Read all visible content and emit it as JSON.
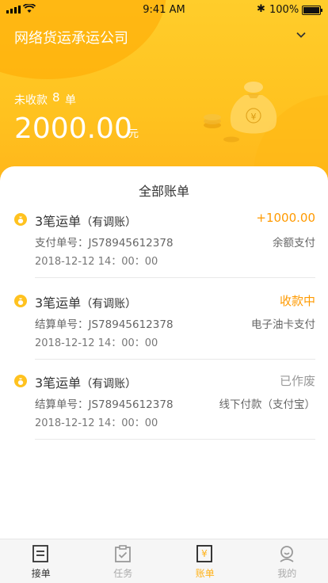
{
  "status_bar": {
    "time": "9:41 AM",
    "battery": "100%"
  },
  "header": {
    "company": "网络货运承运公司",
    "unpaid_label": "未收款",
    "unpaid_count": "8",
    "unpaid_unit": "单",
    "amount": "2000.00",
    "amount_unit": "元"
  },
  "sheet": {
    "title": "全部账单"
  },
  "bills": [
    {
      "title": "3笔运单",
      "note": "（有调账）",
      "right": "+1000.00",
      "right_color": "#ff9a00",
      "sub_left": "支付单号：JS78945612378",
      "sub_right": "余额支付",
      "date": "2018-12-12  14：00：00"
    },
    {
      "title": "3笔运单",
      "note": "（有调账）",
      "right": "收款中",
      "right_color": "#ff9a00",
      "sub_left": "结算单号：JS78945612378",
      "sub_right": "电子油卡支付",
      "date": "2018-12-12  14：00：00"
    },
    {
      "title": "3笔运单",
      "note": "（有调账）",
      "right": "已作废",
      "right_color": "#999999",
      "sub_left": "结算单号：JS78945612378",
      "sub_right": "线下付款（支付宝）",
      "date": "2018-12-12  14：00：00"
    }
  ],
  "tabs": [
    {
      "label": "接单",
      "icon": "list-icon"
    },
    {
      "label": "任务",
      "icon": "clipboard-icon"
    },
    {
      "label": "账单",
      "icon": "bill-icon"
    },
    {
      "label": "我的",
      "icon": "user-icon"
    }
  ],
  "colors": {
    "accent": "#ffb21a",
    "hero": "#ffc21f"
  }
}
